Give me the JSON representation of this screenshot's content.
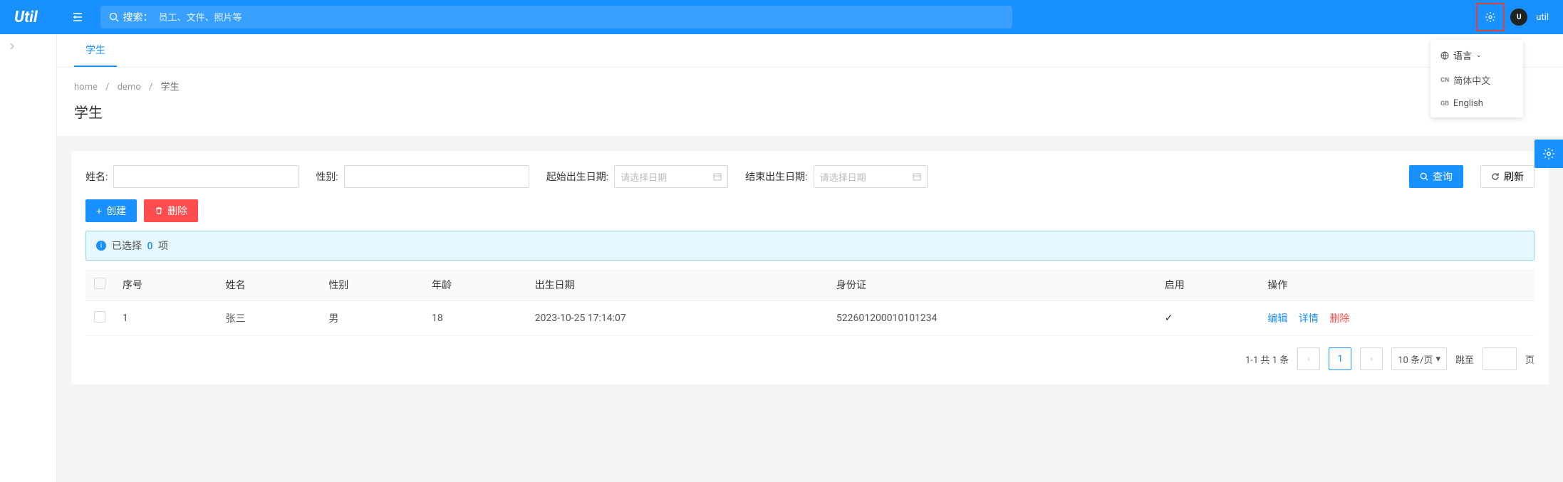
{
  "header": {
    "logo": "Util",
    "search_prefix": "搜索：",
    "search_placeholder": "员工、文件、照片等",
    "username": "util"
  },
  "tabs": [
    {
      "label": "学生"
    }
  ],
  "breadcrumb": {
    "items": [
      "home",
      "demo"
    ],
    "current": "学生"
  },
  "page_title": "学生",
  "filters": {
    "name_label": "姓名:",
    "gender_label": "性别:",
    "start_date_label": "起始出生日期:",
    "end_date_label": "结束出生日期:",
    "date_placeholder": "请选择日期",
    "query_btn": "查询",
    "refresh_btn": "刷新"
  },
  "actions": {
    "create_btn": "创建",
    "delete_btn": "删除"
  },
  "selection_banner": {
    "prefix": "已选择",
    "count": "0",
    "suffix": "项"
  },
  "table": {
    "columns": [
      "序号",
      "姓名",
      "性别",
      "年龄",
      "出生日期",
      "身份证",
      "启用",
      "操作"
    ],
    "rows": [
      {
        "index": "1",
        "name": "张三",
        "gender": "男",
        "age": "18",
        "birth": "2023-10-25 17:14:07",
        "id_card": "522601200010101234",
        "enabled": true
      }
    ],
    "row_actions": {
      "edit": "编辑",
      "detail": "详情",
      "delete": "删除"
    }
  },
  "pagination": {
    "total_text": "1-1 共 1 条",
    "current": "1",
    "page_size_label": "10 条/页",
    "jump_label": "跳至",
    "page_suffix": "页"
  },
  "dropdown": {
    "title": "语言",
    "options": [
      {
        "code": "CN",
        "label": "简体中文"
      },
      {
        "code": "GB",
        "label": "English"
      }
    ]
  }
}
